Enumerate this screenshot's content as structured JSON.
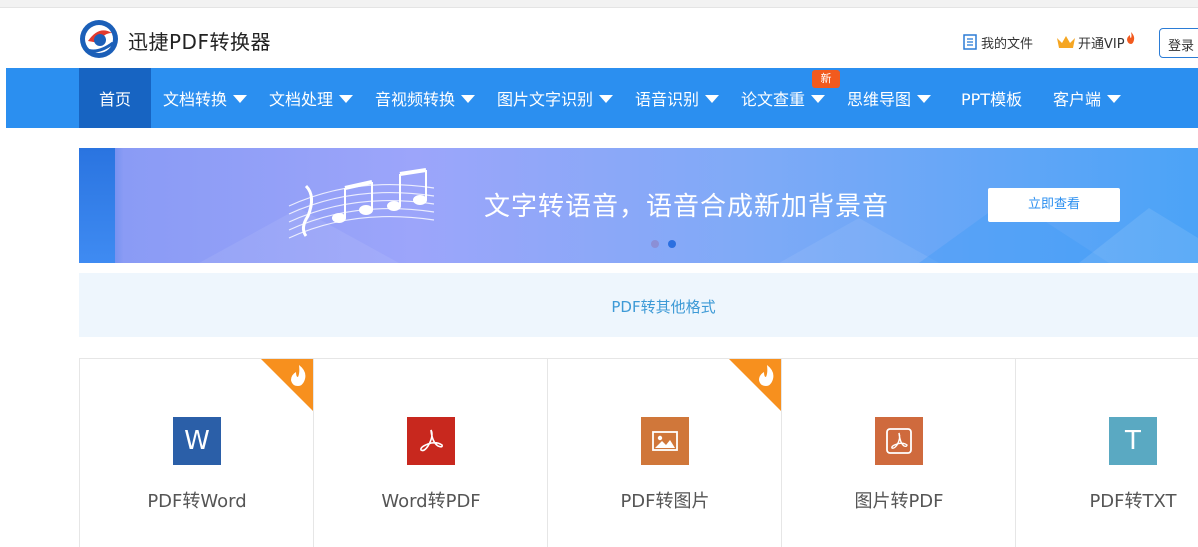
{
  "header": {
    "brand": "迅捷PDF转换器",
    "my_files": "我的文件",
    "vip": "开通VIP",
    "login": "登录"
  },
  "nav": {
    "items": [
      {
        "label": "首页",
        "dropdown": false,
        "active": true
      },
      {
        "label": "文档转换",
        "dropdown": true
      },
      {
        "label": "文档处理",
        "dropdown": true
      },
      {
        "label": "音视频转换",
        "dropdown": true
      },
      {
        "label": "图片文字识别",
        "dropdown": true
      },
      {
        "label": "语音识别",
        "dropdown": true
      },
      {
        "label": "论文查重",
        "dropdown": true,
        "badge": "新"
      },
      {
        "label": "思维导图",
        "dropdown": true
      },
      {
        "label": "PPT模板",
        "dropdown": false
      },
      {
        "label": "客户端",
        "dropdown": true
      }
    ]
  },
  "banner": {
    "text": "文字转语音，语音合成新加背景音",
    "button": "立即查看",
    "active_slide": 2,
    "slide_count": 2
  },
  "section": {
    "title": "PDF转其他格式"
  },
  "cards": [
    {
      "label": "PDF转Word",
      "icon": "word-icon",
      "icon_glyph": "W",
      "color": "#2b5fa8",
      "hot": true
    },
    {
      "label": "Word转PDF",
      "icon": "pdf-icon",
      "icon_glyph": "",
      "color": "#c8281e",
      "hot": false
    },
    {
      "label": "PDF转图片",
      "icon": "image-icon",
      "icon_glyph": "",
      "color": "#d0773a",
      "hot": true
    },
    {
      "label": "图片转PDF",
      "icon": "pdf-box-icon",
      "icon_glyph": "",
      "color": "#cf6a3d",
      "hot": false
    },
    {
      "label": "PDF转TXT",
      "icon": "text-icon",
      "icon_glyph": "T",
      "color": "#5aa9c2",
      "hot": false
    }
  ],
  "colors": {
    "nav_bg": "#2b8ff0",
    "nav_active": "#1764c2",
    "badge": "#f25a1e",
    "hot": "#f7901e",
    "section_text": "#3d9ad6"
  }
}
